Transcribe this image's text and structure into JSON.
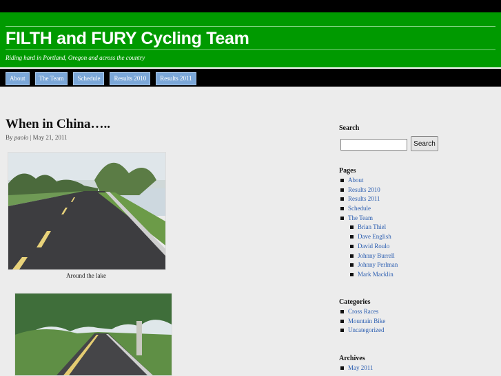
{
  "site": {
    "title": "FILTH and FURY Cycling Team",
    "tagline": "Riding hard in Portland, Oregon and across the country"
  },
  "nav": [
    "About",
    "The Team",
    "Schedule",
    "Results 2010",
    "Results 2011"
  ],
  "post": {
    "title": "When in China…..",
    "by": "By",
    "author": "paolo",
    "date": "May 21, 2011",
    "caption1": "Around the lake"
  },
  "sidebar": {
    "search_heading": "Search",
    "search_button": "Search",
    "pages_heading": "Pages",
    "pages": [
      "About",
      "Results 2010",
      "Results 2011",
      "Schedule",
      "The Team"
    ],
    "team": [
      "Brian Thiel",
      "Dave English",
      "David Roulo",
      "Johnny Burrell",
      "Johnny Perlman",
      "Mark Macklin"
    ],
    "categories_heading": "Categories",
    "categories": [
      "Cross Races",
      "Mountain Bike",
      "Uncategorized"
    ],
    "archives_heading": "Archives",
    "archives": [
      "May 2011"
    ]
  }
}
